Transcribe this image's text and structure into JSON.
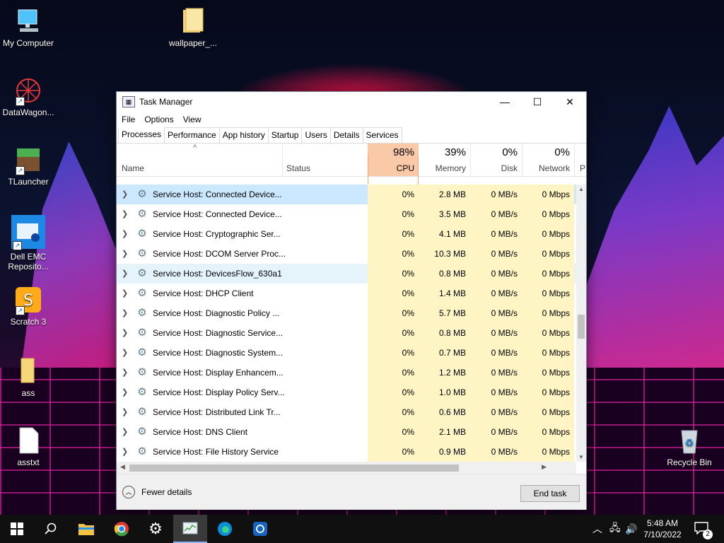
{
  "desktop": {
    "icons": [
      {
        "label": "My Computer"
      },
      {
        "label": "wallpaper_..."
      },
      {
        "label": "DataWagon..."
      },
      {
        "label": "TLauncher"
      },
      {
        "label": "Dell EMC Reposito..."
      },
      {
        "label": "Scratch 3"
      },
      {
        "label": "ass"
      },
      {
        "label": "asstxt"
      },
      {
        "label": "Recycle Bin"
      }
    ]
  },
  "window": {
    "title": "Task Manager",
    "controls": {
      "minimize": "—",
      "maximize": "☐",
      "close": "✕"
    },
    "menu": [
      "File",
      "Options",
      "View"
    ],
    "tabs": [
      "Processes",
      "Performance",
      "App history",
      "Startup",
      "Users",
      "Details",
      "Services"
    ],
    "active_tab": "Processes",
    "columns": {
      "sort_arrow": "^",
      "name": "Name",
      "status": "Status",
      "cpu": {
        "pct": "98%",
        "label": "CPU"
      },
      "memory": {
        "pct": "39%",
        "label": "Memory"
      },
      "disk": {
        "pct": "0%",
        "label": "Disk"
      },
      "network": {
        "pct": "0%",
        "label": "Network"
      },
      "more": "P"
    },
    "rows": [
      {
        "name": "Service Host: Connected Device...",
        "cpu": "0%",
        "memory": "2.8 MB",
        "disk": "0 MB/s",
        "network": "0 Mbps"
      },
      {
        "name": "Service Host: Connected Device...",
        "cpu": "0%",
        "memory": "3.5 MB",
        "disk": "0 MB/s",
        "network": "0 Mbps"
      },
      {
        "name": "Service Host: Cryptographic Ser...",
        "cpu": "0%",
        "memory": "4.1 MB",
        "disk": "0 MB/s",
        "network": "0 Mbps"
      },
      {
        "name": "Service Host: DCOM Server Proc...",
        "cpu": "0%",
        "memory": "10.3 MB",
        "disk": "0 MB/s",
        "network": "0 Mbps"
      },
      {
        "name": "Service Host: DevicesFlow_630a1",
        "cpu": "0%",
        "memory": "0.8 MB",
        "disk": "0 MB/s",
        "network": "0 Mbps"
      },
      {
        "name": "Service Host: DHCP Client",
        "cpu": "0%",
        "memory": "1.4 MB",
        "disk": "0 MB/s",
        "network": "0 Mbps"
      },
      {
        "name": "Service Host: Diagnostic Policy ...",
        "cpu": "0%",
        "memory": "5.7 MB",
        "disk": "0 MB/s",
        "network": "0 Mbps"
      },
      {
        "name": "Service Host: Diagnostic Service...",
        "cpu": "0%",
        "memory": "0.8 MB",
        "disk": "0 MB/s",
        "network": "0 Mbps"
      },
      {
        "name": "Service Host: Diagnostic System...",
        "cpu": "0%",
        "memory": "0.7 MB",
        "disk": "0 MB/s",
        "network": "0 Mbps"
      },
      {
        "name": "Service Host: Display Enhancem...",
        "cpu": "0%",
        "memory": "1.2 MB",
        "disk": "0 MB/s",
        "network": "0 Mbps"
      },
      {
        "name": "Service Host: Display Policy Serv...",
        "cpu": "0%",
        "memory": "1.0 MB",
        "disk": "0 MB/s",
        "network": "0 Mbps"
      },
      {
        "name": "Service Host: Distributed Link Tr...",
        "cpu": "0%",
        "memory": "0.6 MB",
        "disk": "0 MB/s",
        "network": "0 Mbps"
      },
      {
        "name": "Service Host: DNS Client",
        "cpu": "0%",
        "memory": "2.1 MB",
        "disk": "0 MB/s",
        "network": "0 Mbps"
      },
      {
        "name": "Service Host: File History Service",
        "cpu": "0%",
        "memory": "0.9 MB",
        "disk": "0 MB/s",
        "network": "0 Mbps"
      }
    ],
    "footer": {
      "fewer_details": "Fewer details",
      "end_task": "End task"
    }
  },
  "taskbar": {
    "clock_time": "5:48 AM",
    "clock_date": "7/10/2022",
    "notification_count": "2"
  },
  "colors": {
    "cpu_header": "#f9c9a8",
    "heat_cell": "#fff4c4",
    "selected_row": "#cce8ff",
    "taskbar": "#101010"
  }
}
